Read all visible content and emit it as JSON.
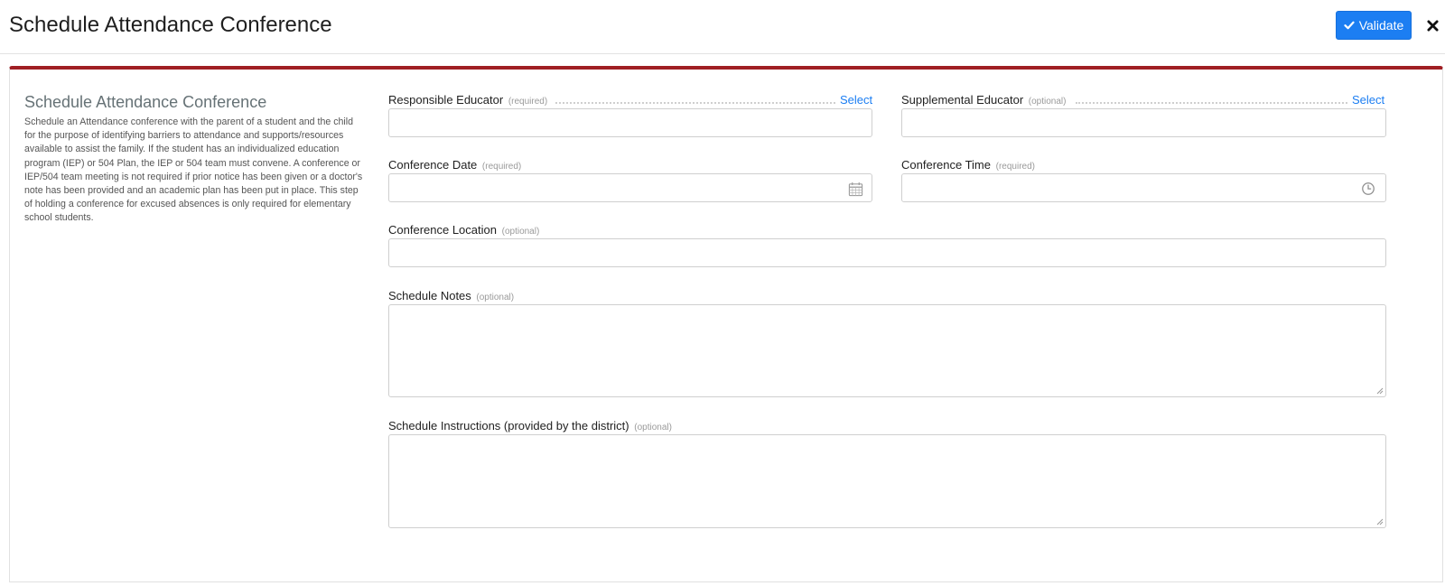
{
  "header": {
    "title": "Schedule Attendance Conference",
    "validate_label": "Validate",
    "icons": {
      "validate": "check-icon",
      "close": "close-icon"
    },
    "accent_color": "#1c7ef2"
  },
  "panel": {
    "border_color": "#a01f24",
    "side": {
      "title": "Schedule Attendance Conference",
      "description": "Schedule an Attendance conference with the parent of a student and the child for the purpose of identifying barriers to attendance and supports/resources available to assist the family. If the student has an individualized education program (IEP) or 504 Plan, the IEP or 504 team must convene. A conference or IEP/504 team meeting is not required if prior notice has been given or a doctor's note has been provided and an academic plan has been put in place. This step of holding a conference for excused absences is only required for elementary school students."
    },
    "fields": {
      "responsible_educator": {
        "label": "Responsible Educator",
        "hint": "(required)",
        "action": "Select",
        "value": ""
      },
      "supplemental_educator": {
        "label": "Supplemental Educator",
        "hint": "(optional)",
        "action": "Select",
        "value": ""
      },
      "conference_date": {
        "label": "Conference Date",
        "hint": "(required)",
        "value": "",
        "icon": "calendar-icon"
      },
      "conference_time": {
        "label": "Conference Time",
        "hint": "(required)",
        "value": "",
        "icon": "clock-icon"
      },
      "conference_location": {
        "label": "Conference Location",
        "hint": "(optional)",
        "value": ""
      },
      "schedule_notes": {
        "label": "Schedule Notes",
        "hint": "(optional)",
        "value": ""
      },
      "schedule_instructions": {
        "label": "Schedule Instructions (provided by the district)",
        "hint": "(optional)",
        "value": ""
      }
    }
  }
}
